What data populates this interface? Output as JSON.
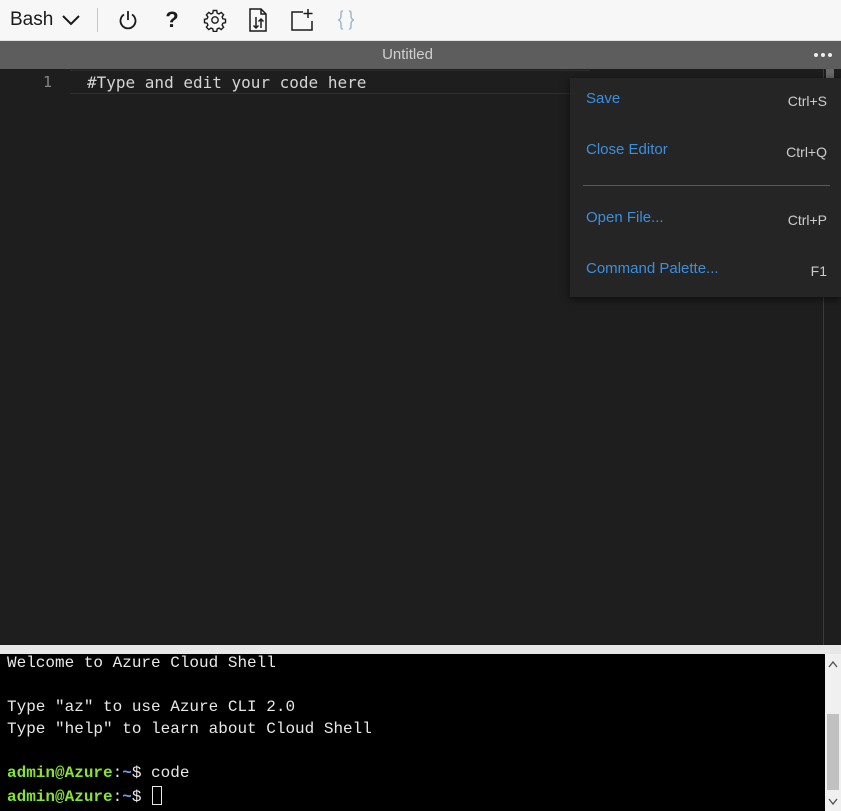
{
  "toolbar": {
    "shell_label": "Bash",
    "help_label": "?",
    "buttons": [
      "power-icon",
      "help-icon",
      "gear-icon",
      "upload-download-icon",
      "new-file-icon",
      "braces-icon"
    ]
  },
  "editor": {
    "title": "Untitled",
    "line_number": "1",
    "code": "#Type and edit your code here"
  },
  "menu": {
    "items": [
      {
        "label": "Save",
        "shortcut": "Ctrl+S"
      },
      {
        "label": "Close Editor",
        "shortcut": "Ctrl+Q"
      },
      {
        "label": "Open File...",
        "shortcut": "Ctrl+P"
      },
      {
        "label": "Command Palette...",
        "shortcut": "F1"
      }
    ]
  },
  "terminal": {
    "welcome": "Welcome to Azure Cloud Shell",
    "hint_az": "Type \"az\" to use Azure CLI 2.0",
    "hint_help": "Type \"help\" to learn about Cloud Shell",
    "prompt_user": "admin@Azure",
    "prompt_colon": ":",
    "prompt_path": "~",
    "prompt_symbol": "$ ",
    "command_1": "code"
  },
  "colors": {
    "menu_label": "#3c8fde",
    "prompt_user": "#8ae234",
    "prompt_path": "#6aa0f0",
    "editor_bg": "#1e1e1e",
    "titlebar_bg": "#5d5d5d"
  }
}
